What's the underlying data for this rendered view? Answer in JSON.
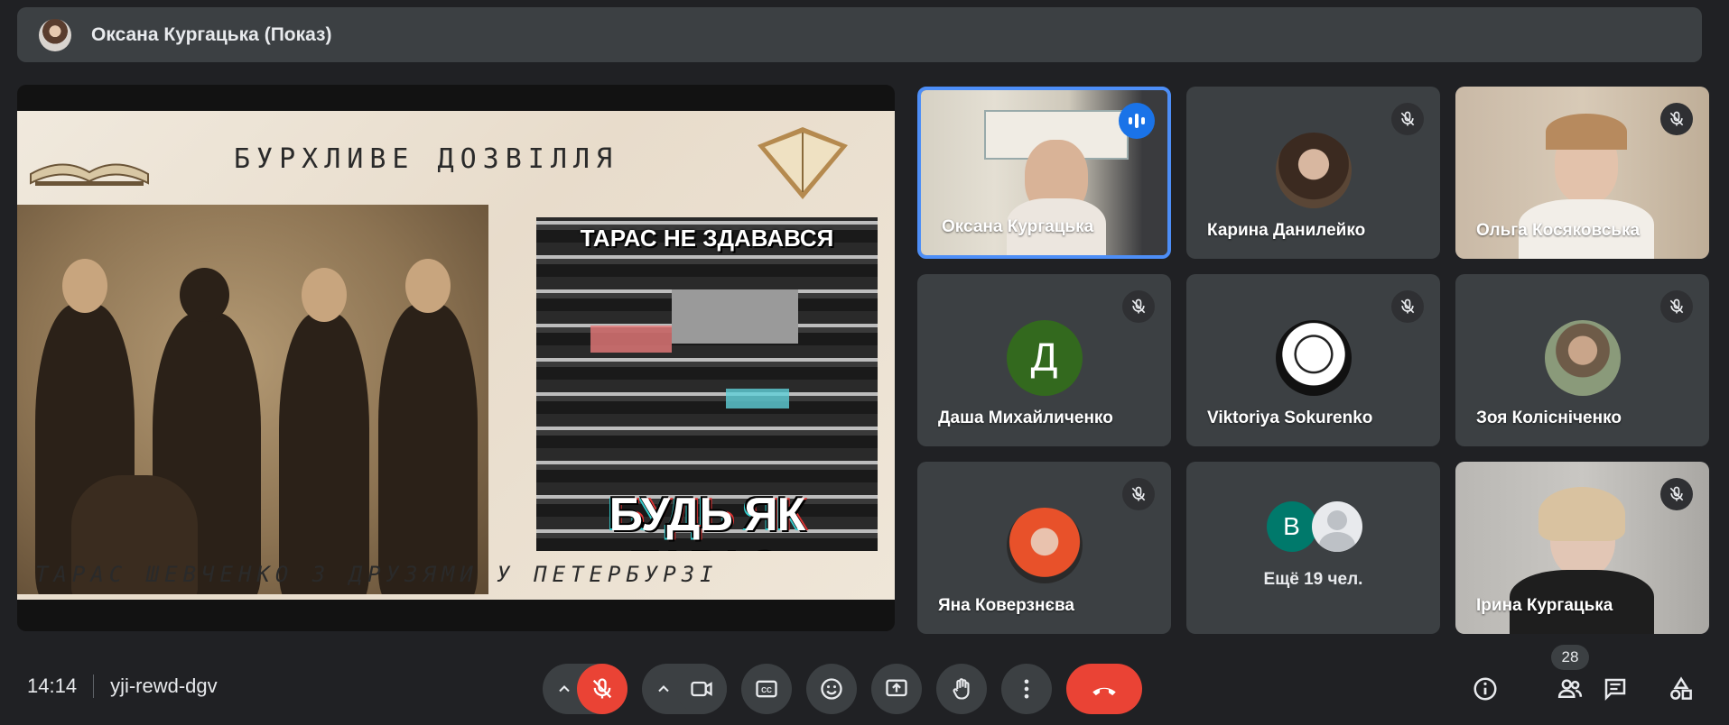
{
  "header": {
    "presenter_title": "Оксана Кургацька (Показ)"
  },
  "slide": {
    "title": "БУРХЛИВЕ ДОЗВІЛЛЯ",
    "meme_top": "ТАРАС НЕ ЗДАВАВСЯ",
    "meme_bottom": "БУДЬ ЯК ТАРАС",
    "caption": "ТАРАС ШЕВЧЕНКО З ДРУЗЯМИ У ПЕТЕРБУРЗІ"
  },
  "participants": [
    {
      "name": "Оксана Кургацька",
      "status": "speaking"
    },
    {
      "name": "Карина Данилейко",
      "status": "muted"
    },
    {
      "name": "Ольга Косяковська",
      "status": "muted"
    },
    {
      "name": "Даша Михайличенко",
      "status": "muted",
      "initial": "Д"
    },
    {
      "name": "Viktoriya Sokurenko",
      "status": "muted"
    },
    {
      "name": "Зоя Колісніченко",
      "status": "muted"
    },
    {
      "name": "Яна Коверзнєва",
      "status": "muted"
    },
    {
      "name": "Ірина Кургацька",
      "status": "muted"
    }
  ],
  "others": {
    "initial": "B",
    "label": "Ещё 19 чел."
  },
  "footer": {
    "time": "14:14",
    "meeting_code": "yji-rewd-dgv",
    "participant_count": "28"
  },
  "colors": {
    "background": "#202124",
    "tile": "#3c4043",
    "accent_blue": "#1a73e8",
    "danger_red": "#ea4335"
  }
}
